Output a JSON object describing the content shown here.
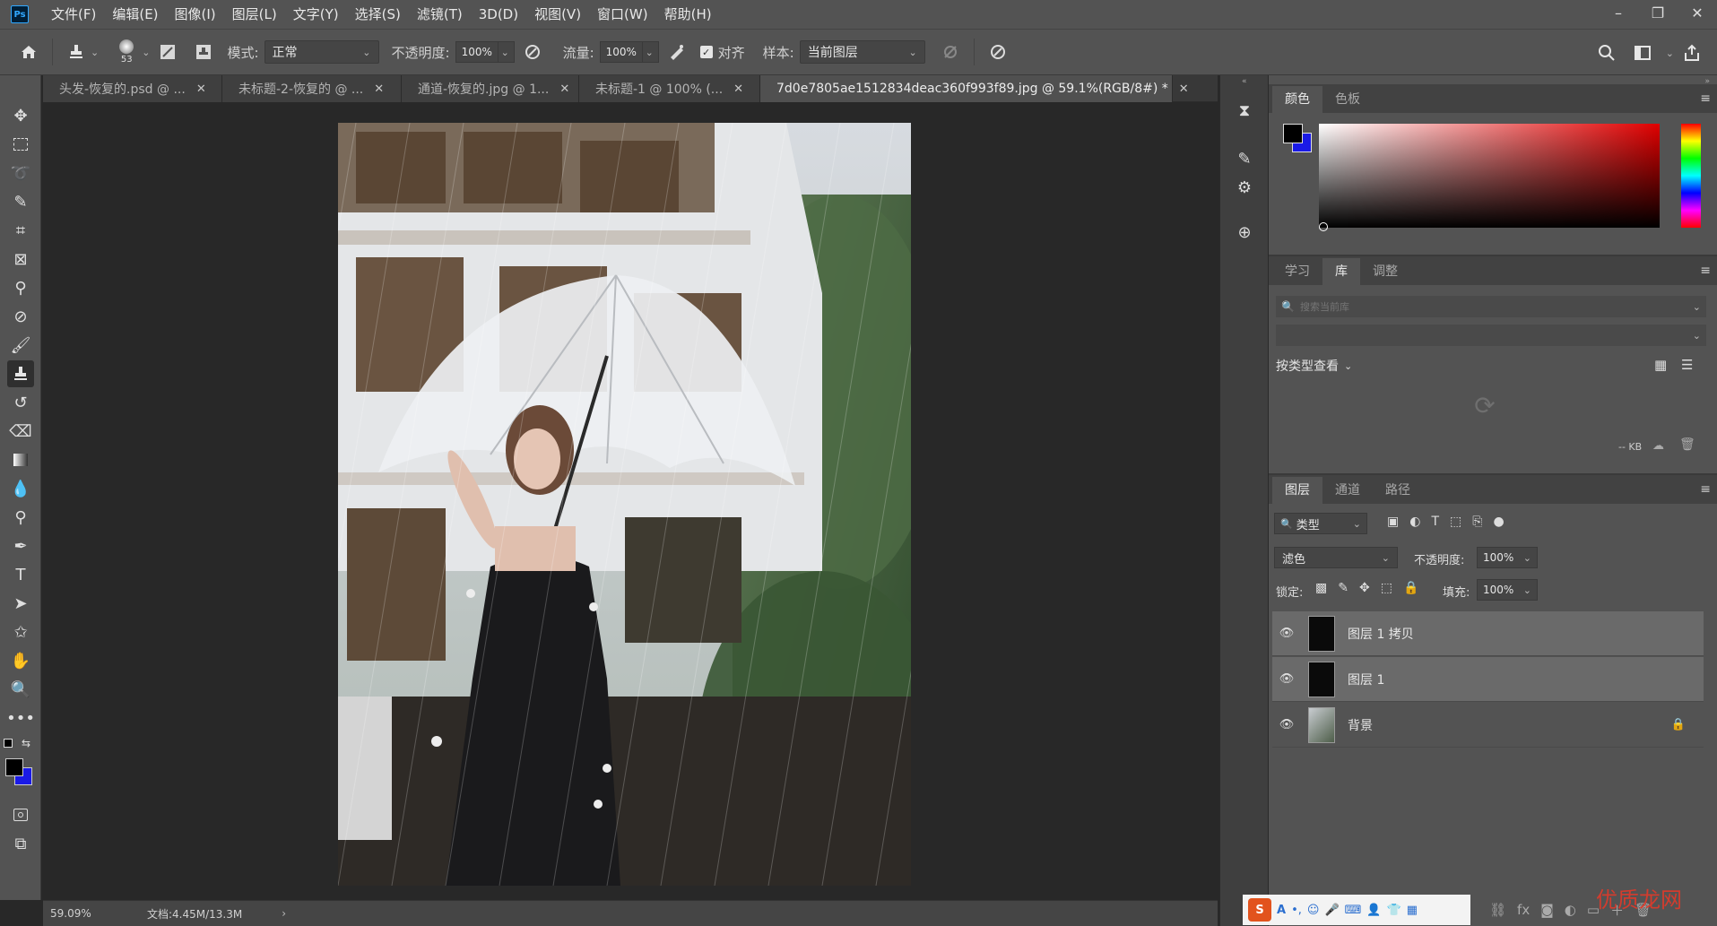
{
  "app": {
    "logo": "Ps",
    "menu": [
      "文件(F)",
      "编辑(E)",
      "图像(I)",
      "图层(L)",
      "文字(Y)",
      "选择(S)",
      "滤镜(T)",
      "3D(D)",
      "视图(V)",
      "窗口(W)",
      "帮助(H)"
    ]
  },
  "options": {
    "brush_size": "53",
    "mode_label": "模式:",
    "mode_value": "正常",
    "opacity_label": "不透明度:",
    "opacity_value": "100%",
    "flow_label": "流量:",
    "flow_value": "100%",
    "align_label": "对齐",
    "sample_label": "样本:",
    "sample_value": "当前图层"
  },
  "tabs": [
    {
      "label": "头发-恢复的.psd @ ...",
      "active": false
    },
    {
      "label": "未标题-2-恢复的 @ ...",
      "active": false
    },
    {
      "label": "通道-恢复的.jpg @ 1...",
      "active": false
    },
    {
      "label": "未标题-1 @ 100% (...",
      "active": false
    },
    {
      "label": "7d0e7805ae1512834deac360f993f89.jpg @ 59.1%(RGB/8#) *",
      "active": true
    }
  ],
  "status": {
    "zoom": "59.09%",
    "doc_info": "文档:4.45M/13.3M"
  },
  "color_panel": {
    "tabs": [
      "颜色",
      "色板"
    ],
    "fg_color": "#000000",
    "bg_color": "#1a1ae6"
  },
  "library_panel": {
    "tabs": [
      "学习",
      "库",
      "调整"
    ],
    "search_placeholder": "搜索当前库",
    "view_label": "按类型查看",
    "size_label": "-- KB"
  },
  "layers_panel": {
    "tabs": [
      "图层",
      "通道",
      "路径"
    ],
    "filter_label": "类型",
    "blend_mode": "滤色",
    "opacity_label": "不透明度:",
    "opacity_value": "100%",
    "lock_label": "锁定:",
    "fill_label": "填充:",
    "fill_value": "100%",
    "layers": [
      {
        "name": "图层 1 拷贝",
        "selected": true
      },
      {
        "name": "图层 1",
        "selected": true
      },
      {
        "name": "背景",
        "selected": false,
        "locked": true
      }
    ]
  },
  "watermark": "优质龙网"
}
